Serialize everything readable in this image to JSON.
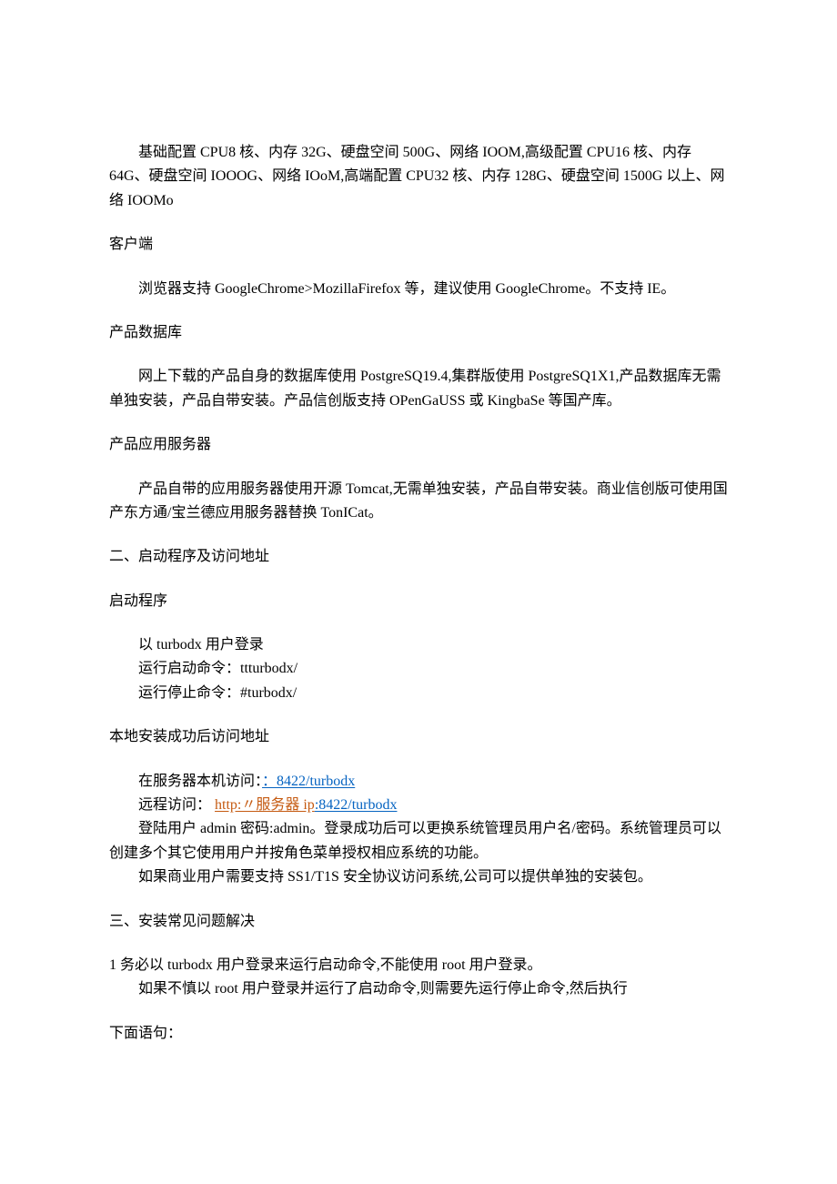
{
  "p1": "基础配置 CPU8 核、内存 32G、硬盘空间 500G、网络 IOOM,高级配置 CPU16 核、内存 64G、硬盘空间 IOOOG、网络 IOoM,高端配置 CPU32 核、内存 128G、硬盘空间 1500G 以上、网络 IOOMo",
  "h_client": "客户端",
  "p_client": "浏览器支持 GoogleChrome>MozillaFirefox 等，建议使用 GoogleChrome。不支持 IE。",
  "h_db": "产品数据库",
  "p_db": "网上下载的产品自身的数据库使用 PostgreSQ19.4,集群版使用 PostgreSQ1X1,产品数据库无需单独安装，产品自带安装。产品信创版支持 OPenGaUSS 或 KingbaSe 等国产库。",
  "h_app": "产品应用服务器",
  "p_app": "产品自带的应用服务器使用开源 Tomcat,无需单独安装，产品自带安装。商业信创版可使用国产东方通/宝兰德应用服务器替换 TonICat。",
  "h_sec2": "二、启动程序及访问地址",
  "h_start": "启动程序",
  "start_l1": "以 turbodx 用户登录",
  "start_l2": "运行启动命令：ttturbodx/",
  "start_l3": "运行停止命令：#turbodx/",
  "h_local": "本地安装成功后访问地址",
  "local_l1_a": "在服务器本机访问：",
  "local_l1_link": "：8422/turbodx",
  "local_l2_a": "远程访问： ",
  "local_l2_link_red": "http:〃服务器 ip",
  "local_l2_link_blue": ":8422/turbodx",
  "local_l3": "登陆用户 admin 密码:admin。登录成功后可以更换系统管理员用户名/密码。系统管理员可以创建多个其它使用用户并按角色菜单授权相应系统的功能。",
  "local_l4": "如果商业用户需要支持 SS1/T1S 安全协议访问系统,公司可以提供单独的安装包。",
  "h_sec3": "三、安装常见问题解决",
  "faq_l1": "1 务必以 turbodx 用户登录来运行启动命令,不能使用 root 用户登录。",
  "faq_l2": "如果不慎以 root 用户登录并运行了启动命令,则需要先运行停止命令,然后执行",
  "p_next": "下面语句："
}
